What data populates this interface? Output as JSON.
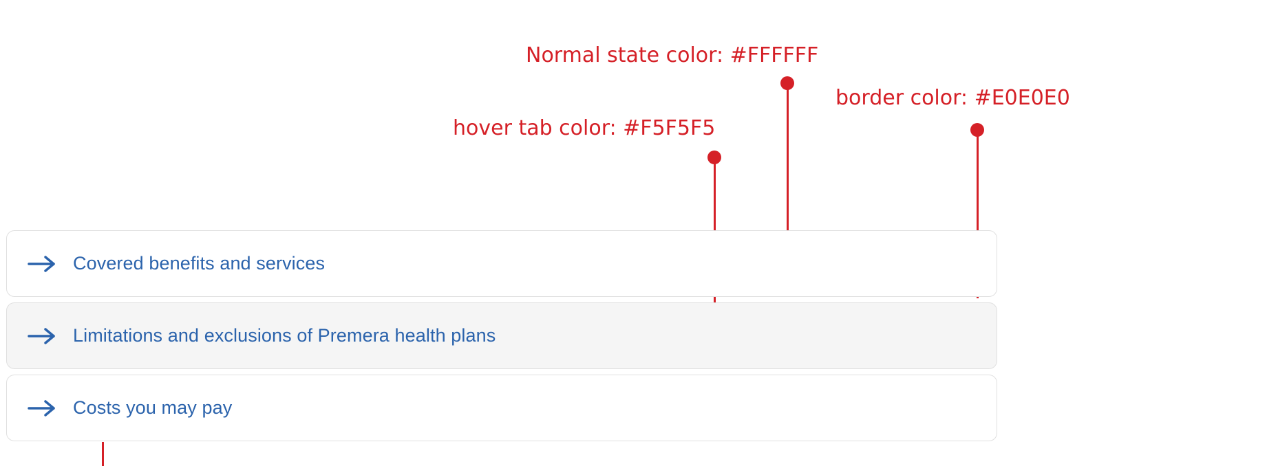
{
  "annotations": {
    "normal_state": "Normal state color: #FFFFFF",
    "border_color": "border color: #E0E0E0",
    "hover_tab": "hover tab color: #F5F5F5"
  },
  "colors": {
    "annotation_red": "#D52027",
    "normal_state": "#FFFFFF",
    "hover_tab": "#F5F5F5",
    "border": "#E0E0E0",
    "link_blue": "#2B63AC"
  },
  "tabs": [
    {
      "label": "Covered benefits and services",
      "state": "normal",
      "icon": "arrow-right-icon"
    },
    {
      "label": "Limitations and exclusions of Premera health plans",
      "state": "hover",
      "icon": "arrow-right-icon"
    },
    {
      "label": "Costs you may pay",
      "state": "normal",
      "icon": "arrow-right-icon"
    }
  ]
}
